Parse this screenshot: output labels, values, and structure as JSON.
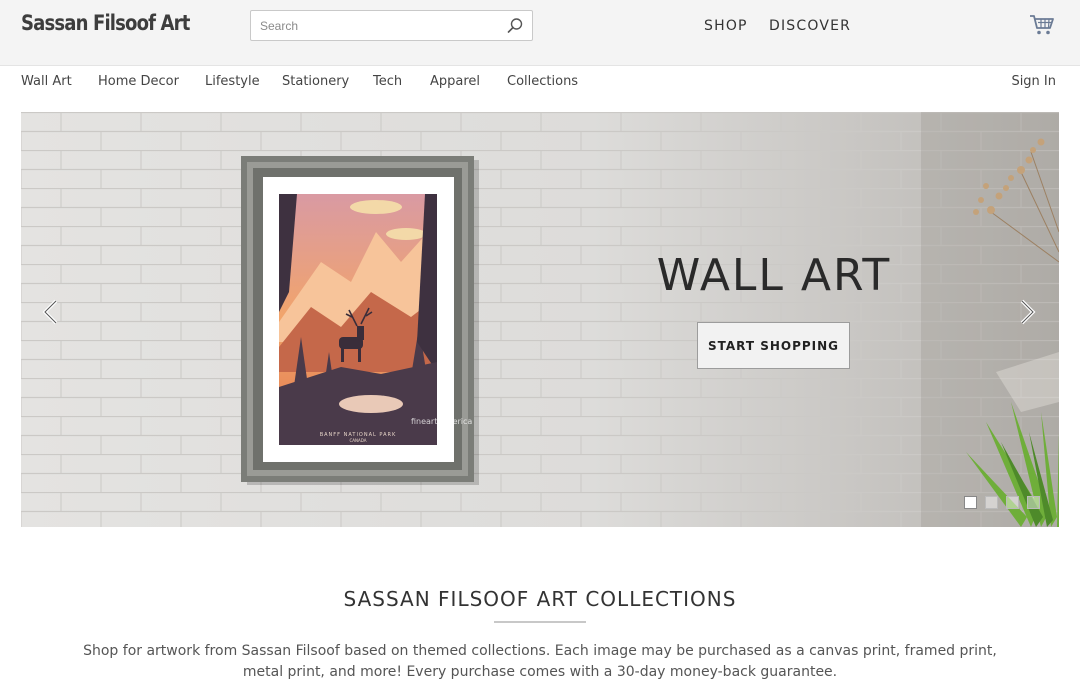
{
  "header": {
    "logo": "Sassan Filsoof Art",
    "search_placeholder": "Search",
    "nav": {
      "shop": "SHOP",
      "discover": "DISCOVER"
    }
  },
  "categories": [
    "Wall Art",
    "Home Decor",
    "Lifestyle",
    "Stationery",
    "Tech",
    "Apparel",
    "Collections"
  ],
  "sign_in": "Sign In",
  "hero": {
    "title": "WALL ART",
    "button": "START SHOPPING",
    "poster_caption": "BANFF NATIONAL PARK",
    "poster_subcaption": "CANADA",
    "watermark": "fineart america",
    "slides": 4,
    "active_slide": 1
  },
  "collections": {
    "title": "SASSAN FILSOOF ART COLLECTIONS",
    "description": "Shop for artwork from Sassan Filsoof based on themed collections. Each image may be purchased as a canvas print, framed print, metal print, and more! Every purchase comes with a 30-day money-back guarantee."
  },
  "icons": {
    "search": "search-icon",
    "cart": "cart-icon",
    "prev": "chevron-left-icon",
    "next": "chevron-right-icon"
  },
  "colors": {
    "header_bg": "#f4f4f4",
    "text": "#333333",
    "poster_sky": "#f2a46a",
    "poster_dark": "#4a3a4a"
  }
}
